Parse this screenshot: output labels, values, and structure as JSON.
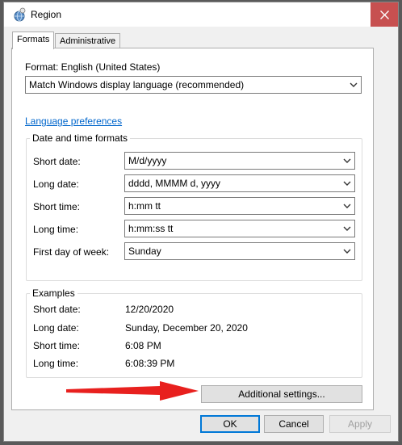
{
  "window": {
    "title": "Region"
  },
  "tabs": [
    {
      "label": "Formats",
      "active": true
    },
    {
      "label": "Administrative",
      "active": false
    }
  ],
  "format": {
    "label": "Format: English (United States)",
    "value": "Match Windows display language (recommended)"
  },
  "language_preferences_link": "Language preferences",
  "date_time_formats": {
    "title": "Date and time formats",
    "rows": [
      {
        "label": "Short date:",
        "value": "M/d/yyyy"
      },
      {
        "label": "Long date:",
        "value": "dddd, MMMM d, yyyy"
      },
      {
        "label": "Short time:",
        "value": "h:mm tt"
      },
      {
        "label": "Long time:",
        "value": "h:mm:ss tt"
      },
      {
        "label": "First day of week:",
        "value": "Sunday"
      }
    ]
  },
  "examples": {
    "title": "Examples",
    "rows": [
      {
        "label": "Short date:",
        "value": "12/20/2020"
      },
      {
        "label": "Long date:",
        "value": "Sunday, December 20, 2020"
      },
      {
        "label": "Short time:",
        "value": "6:08 PM"
      },
      {
        "label": "Long time:",
        "value": "6:08:39 PM"
      }
    ]
  },
  "buttons": {
    "additional_settings": "Additional settings...",
    "ok": "OK",
    "cancel": "Cancel",
    "apply": "Apply"
  },
  "colors": {
    "close_button": "#c75050",
    "link": "#0066cc",
    "annotation_arrow": "#e8201e",
    "default_button_border": "#0078d7"
  },
  "icons": {
    "app": "region-globe-icon",
    "close": "close-icon",
    "dropdown": "chevron-down-icon",
    "annotation": "red-arrow-icon"
  }
}
